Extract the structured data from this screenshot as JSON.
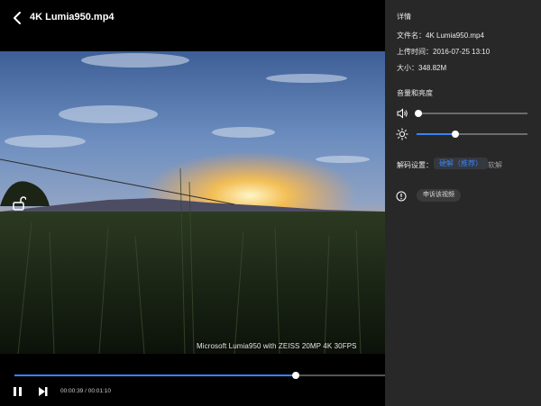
{
  "header": {
    "title": "4K Lumia950.mp4"
  },
  "video": {
    "watermark": "Microsoft Lumia950 with ZEISS 20MP 4K 30FPS"
  },
  "playback": {
    "time": "00:00:39 / 00:01:10",
    "progress": 0.76
  },
  "details": {
    "heading": "详情",
    "filename": "文件名：4K Lumia950.mp4",
    "uploaded": "上传时间：2016-07-25 13:10",
    "size": "大小：348.82M"
  },
  "audio_brightness": {
    "heading": "音量和亮度",
    "volume": 0.02,
    "brightness": 0.35
  },
  "decode": {
    "label": "解码设置：",
    "hardware": "硬解（推荐）",
    "software": "软解"
  },
  "report": {
    "label": "申诉该视频"
  },
  "colors": {
    "accent": "#3b82f6",
    "panel_bg": "#282828"
  },
  "icons": [
    "back-icon",
    "unlock-icon",
    "pause-icon",
    "next-icon",
    "volume-icon",
    "brightness-icon",
    "alert-icon"
  ]
}
